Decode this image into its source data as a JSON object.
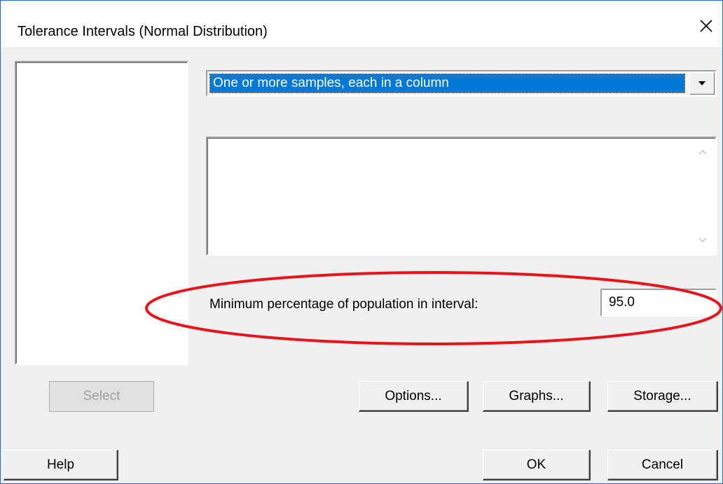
{
  "window": {
    "title": "Tolerance Intervals (Normal Distribution)",
    "close_glyph": "✕"
  },
  "input_mode": {
    "selected": "One or more samples, each in a column"
  },
  "samples": {
    "value": ""
  },
  "population": {
    "label": "Minimum percentage of population in interval:",
    "value": "95.0"
  },
  "buttons": {
    "select": "Select",
    "options": "Options...",
    "graphs": "Graphs...",
    "storage": "Storage...",
    "help": "Help",
    "ok": "OK",
    "cancel": "Cancel"
  },
  "colors": {
    "selection": "#0078d7",
    "highlight_ellipse": "#e8141b",
    "window_border": "#1f6ed4"
  }
}
